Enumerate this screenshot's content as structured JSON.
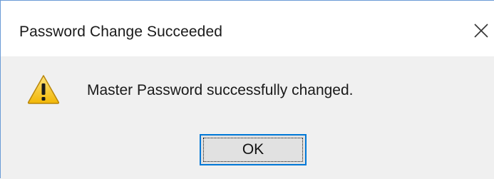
{
  "dialog": {
    "title": "Password Change Succeeded",
    "message": "Master Password successfully changed.",
    "ok_label": "OK",
    "close_icon": "close-icon",
    "status_icon": "warning-icon"
  },
  "colors": {
    "titlebar_bg": "#ffffff",
    "body_bg": "#f0f0f0",
    "window_border": "#6a9bd6",
    "button_bg": "#e1e1e1",
    "button_focus_border": "#0078d7",
    "warning_fill": "#f7c22b",
    "text": "#1a1a1a"
  }
}
